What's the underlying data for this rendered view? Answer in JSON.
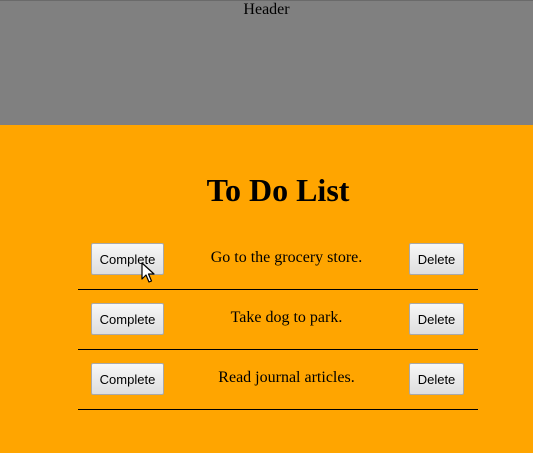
{
  "header": {
    "label": "Header"
  },
  "main": {
    "title": "To Do List"
  },
  "todos": [
    {
      "text": "Go to the grocery store.",
      "complete_label": "Complete",
      "delete_label": "Delete"
    },
    {
      "text": "Take dog to park.",
      "complete_label": "Complete",
      "delete_label": "Delete"
    },
    {
      "text": "Read journal articles.",
      "complete_label": "Complete",
      "delete_label": "Delete"
    }
  ],
  "colors": {
    "header_bg": "#808080",
    "main_bg": "#FFA500"
  },
  "cursor": {
    "icon": "arrow-pointer-icon"
  }
}
